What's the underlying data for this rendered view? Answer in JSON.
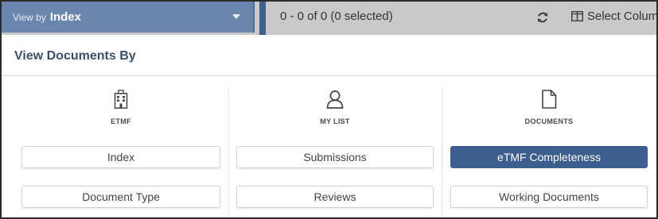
{
  "toolbar": {
    "viewby_prefix": "View by",
    "viewby_value": "Index",
    "count_text": "0 - 0 of 0 (0 selected)",
    "select_columns_label": "Select Colum"
  },
  "panel": {
    "title": "View Documents By",
    "columns": [
      {
        "label": "ETMF",
        "icon": "building-icon",
        "options": [
          "Index",
          "Document Type"
        ]
      },
      {
        "label": "MY LIST",
        "icon": "user-icon",
        "options": [
          "Submissions",
          "Reviews"
        ]
      },
      {
        "label": "DOCUMENTS",
        "icon": "document-icon",
        "options": [
          "eTMF Completeness",
          "Working Documents"
        ],
        "active_option": "eTMF Completeness"
      }
    ]
  },
  "colors": {
    "accent": "#3c5f90",
    "viewby_bg": "#6a86ad",
    "toolbar_bg": "#c9c9c9"
  }
}
